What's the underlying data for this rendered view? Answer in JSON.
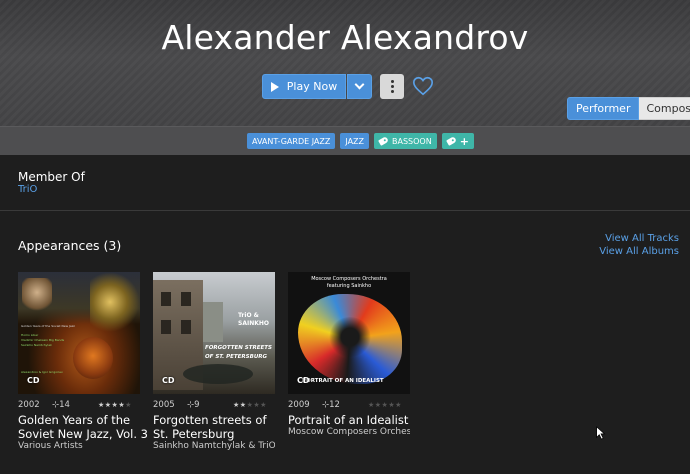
{
  "artist": {
    "name": "Alexander Alexandrov"
  },
  "actions": {
    "play_label": "Play Now",
    "play_icon": "play-icon",
    "dropdown_icon": "chevron-down-icon",
    "more_icon": "more-vertical-icon",
    "favorite_icon": "heart-icon",
    "accent": "#4a90d9"
  },
  "role_toggle": {
    "performer": "Performer",
    "composer": "Composer",
    "selected": "Performer"
  },
  "tags": [
    {
      "label": "AVANT-GARDE JAZZ",
      "color": "#4a90d9"
    },
    {
      "label": "JAZZ",
      "color": "#4a90d9"
    },
    {
      "label": "BASSOON",
      "color": "#3fb6a8",
      "icon": "tag-icon"
    },
    {
      "label": "+",
      "color": "#3fb6a8",
      "icon": "tag-icon"
    }
  ],
  "member_of": {
    "title": "Member Of",
    "groups": [
      "TriO"
    ]
  },
  "appearances": {
    "title": "Appearances (3)",
    "view_all_tracks": "View All Tracks",
    "view_all_albums": "View All Albums",
    "albums": [
      {
        "year": "2002",
        "picks": "14",
        "rating": 4,
        "title": "Golden Years of the Soviet New Jazz, Vol. 3",
        "artist": "Various Artists",
        "format": "CD",
        "cover_text": [
          "Golden Years of the Soviet New Jazz",
          "Homo Liber",
          "Vladimir Chekasin Big Bands",
          "Sainkho Namtchylak",
          "Alexandrov & Igor Grigoriev"
        ]
      },
      {
        "year": "2005",
        "picks": "9",
        "rating": 2,
        "title": "Forgotten streets of St. Petersburg",
        "artist": "Sainkho Namtchylak & TriO",
        "format": "CD",
        "cover_text": [
          "TriO &",
          "SAINKHO",
          "FORGOTTEN STREETS",
          "OF ST. PETERSBURG"
        ]
      },
      {
        "year": "2009",
        "picks": "12",
        "rating": 0,
        "title": "Portrait of an Idealist",
        "artist": "Moscow Composers Orchestra",
        "format": "CD",
        "cover_text": [
          "Moscow Composers Orchestra",
          "featuring Sainkho",
          "PORTRAIT OF AN IDEALIST"
        ]
      }
    ]
  },
  "pick_icon": "pick-icon"
}
